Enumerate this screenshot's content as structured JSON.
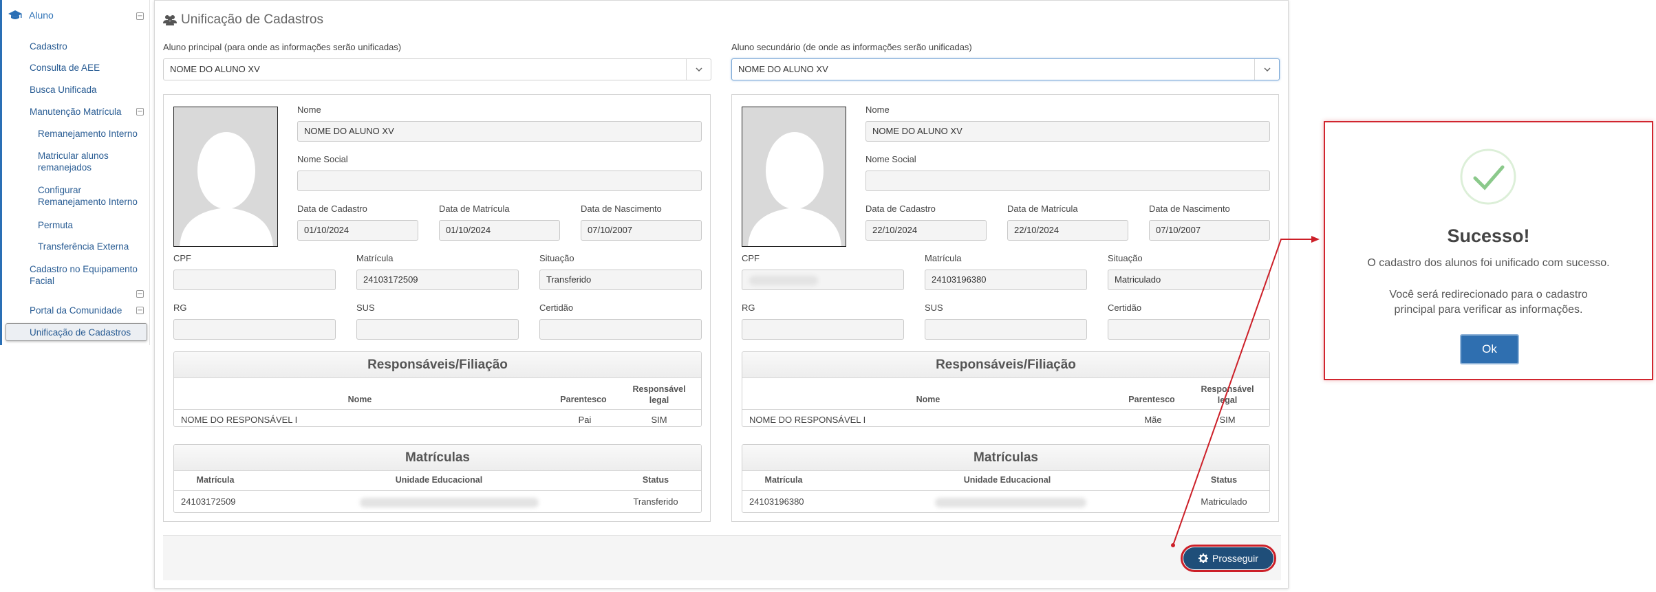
{
  "sidebar": {
    "header": "Aluno",
    "items": [
      {
        "label": "Cadastro"
      },
      {
        "label": "Consulta de AEE"
      },
      {
        "label": "Busca Unificada"
      },
      {
        "label": "Manutenção Matrícula"
      },
      {
        "label": "Remanejamento Interno"
      },
      {
        "label": "Matricular alunos remanejados"
      },
      {
        "label": "Configurar Remanejamento Interno"
      },
      {
        "label": "Permuta"
      },
      {
        "label": "Transferência Externa"
      },
      {
        "label": "Cadastro no Equipamento Facial"
      },
      {
        "label": "Portal da Comunidade"
      },
      {
        "label": "Unificação de Cadastros"
      }
    ]
  },
  "page": {
    "title": "Unificação de Cadastros",
    "principal_label": "Aluno principal (para onde as informações serão unificadas)",
    "secundario_label": "Aluno secundário (de onde as informações serão unificadas)",
    "principal_selected": "NOME DO ALUNO XV",
    "secundario_selected": "NOME DO ALUNO XV",
    "prosseguir": "Prosseguir"
  },
  "labels": {
    "nome": "Nome",
    "nome_social": "Nome Social",
    "data_cadastro": "Data de Cadastro",
    "data_matricula": "Data de Matrícula",
    "data_nascimento": "Data de Nascimento",
    "cpf": "CPF",
    "matricula": "Matrícula",
    "situacao": "Situação",
    "rg": "RG",
    "sus": "SUS",
    "certidao": "Certidão",
    "responsaveis_title": "Responsáveis/Filiação",
    "col_nome": "Nome",
    "col_parentesco": "Parentesco",
    "col_responsavel": "Responsável legal",
    "matriculas_title": "Matrículas",
    "col_matricula": "Matrícula",
    "col_unidade": "Unidade Educacional",
    "col_status": "Status"
  },
  "principal": {
    "nome": "NOME DO ALUNO XV",
    "nome_social": "",
    "data_cadastro": "01/10/2024",
    "data_matricula": "01/10/2024",
    "data_nascimento": "07/10/2007",
    "cpf": "",
    "matricula": "24103172509",
    "situacao": "Transferido",
    "rg": "",
    "sus": "",
    "certidao": "",
    "responsavel": {
      "nome": "NOME DO RESPONSÁVEL I",
      "parentesco": "Pai",
      "legal": "SIM"
    },
    "matricula_row": {
      "matricula": "24103172509",
      "status": "Transferido"
    }
  },
  "secundario": {
    "nome": "NOME DO ALUNO XV",
    "nome_social": "",
    "data_cadastro": "22/10/2024",
    "data_matricula": "22/10/2024",
    "data_nascimento": "07/10/2007",
    "cpf": "",
    "matricula": "24103196380",
    "situacao": "Matriculado",
    "rg": "",
    "sus": "",
    "certidao": "",
    "responsavel": {
      "nome": "NOME DO RESPONSÁVEL I",
      "parentesco": "Mãe",
      "legal": "SIM"
    },
    "matricula_row": {
      "matricula": "24103196380",
      "status": "Matriculado"
    }
  },
  "dialog": {
    "title": "Sucesso!",
    "line1": "O cadastro dos alunos foi unificado com sucesso.",
    "line2": "Você será redirecionado para o cadastro",
    "line3": "principal para verificar as informações.",
    "ok": "Ok"
  },
  "colors": {
    "accent": "#2a6fb5",
    "button_dark": "#1f4e79",
    "highlight_red": "#cc1f28",
    "success_green": "#8bc98b"
  }
}
